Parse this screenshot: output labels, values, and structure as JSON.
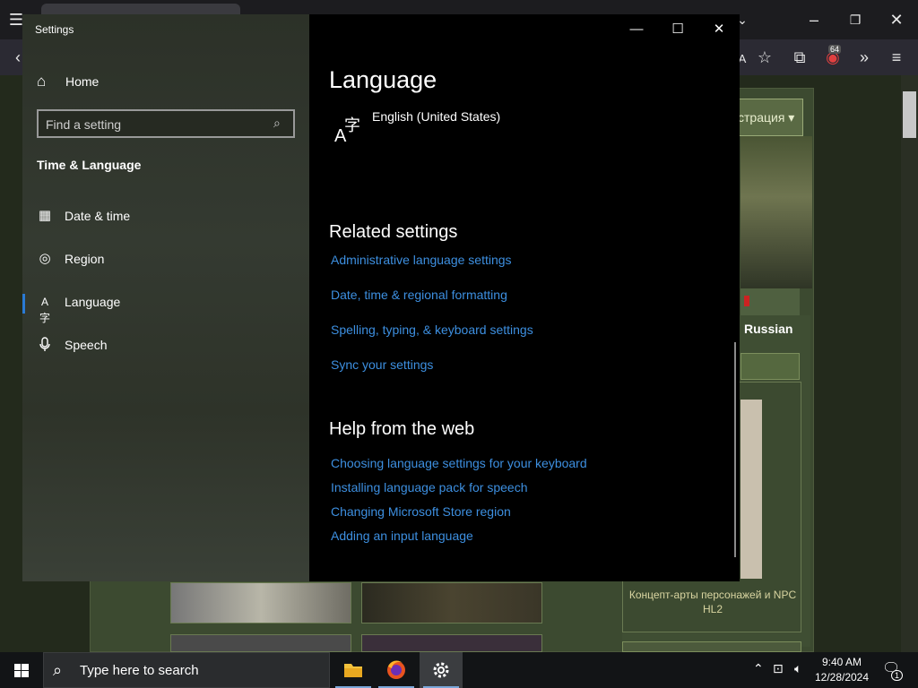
{
  "browser": {
    "toolbar_letter": "A",
    "notification_count": "64",
    "register_label": "страция ▾",
    "language_tab": "Russian",
    "card_caption": "Концепт-арты персонажей и NPC HL2"
  },
  "settings": {
    "window_title": "Settings",
    "home_label": "Home",
    "search_placeholder": "Find a setting",
    "section_title": "Time & Language",
    "nav": [
      {
        "label": "Date & time",
        "icon": "calendar-clock-icon"
      },
      {
        "label": "Region",
        "icon": "globe-icon"
      },
      {
        "label": "Language",
        "icon": "language-icon",
        "active": true
      },
      {
        "label": "Speech",
        "icon": "microphone-icon"
      }
    ],
    "page_title": "Language",
    "current_language": "English (United States)",
    "related_heading": "Related settings",
    "related_links": [
      "Administrative language settings",
      "Date, time & regional formatting",
      "Spelling, typing, & keyboard settings",
      "Sync your settings"
    ],
    "help_heading": "Help from the web",
    "help_links": [
      "Choosing language settings for your keyboard",
      "Installing language pack for speech",
      "Changing Microsoft Store region",
      "Adding an input language"
    ],
    "accent_color": "#3d8fe0"
  },
  "taskbar": {
    "search_text": "Type here to search",
    "apps": [
      "file-explorer",
      "firefox",
      "settings"
    ],
    "time": "9:40 AM",
    "date": "12/28/2024",
    "notification_badge": "1"
  }
}
